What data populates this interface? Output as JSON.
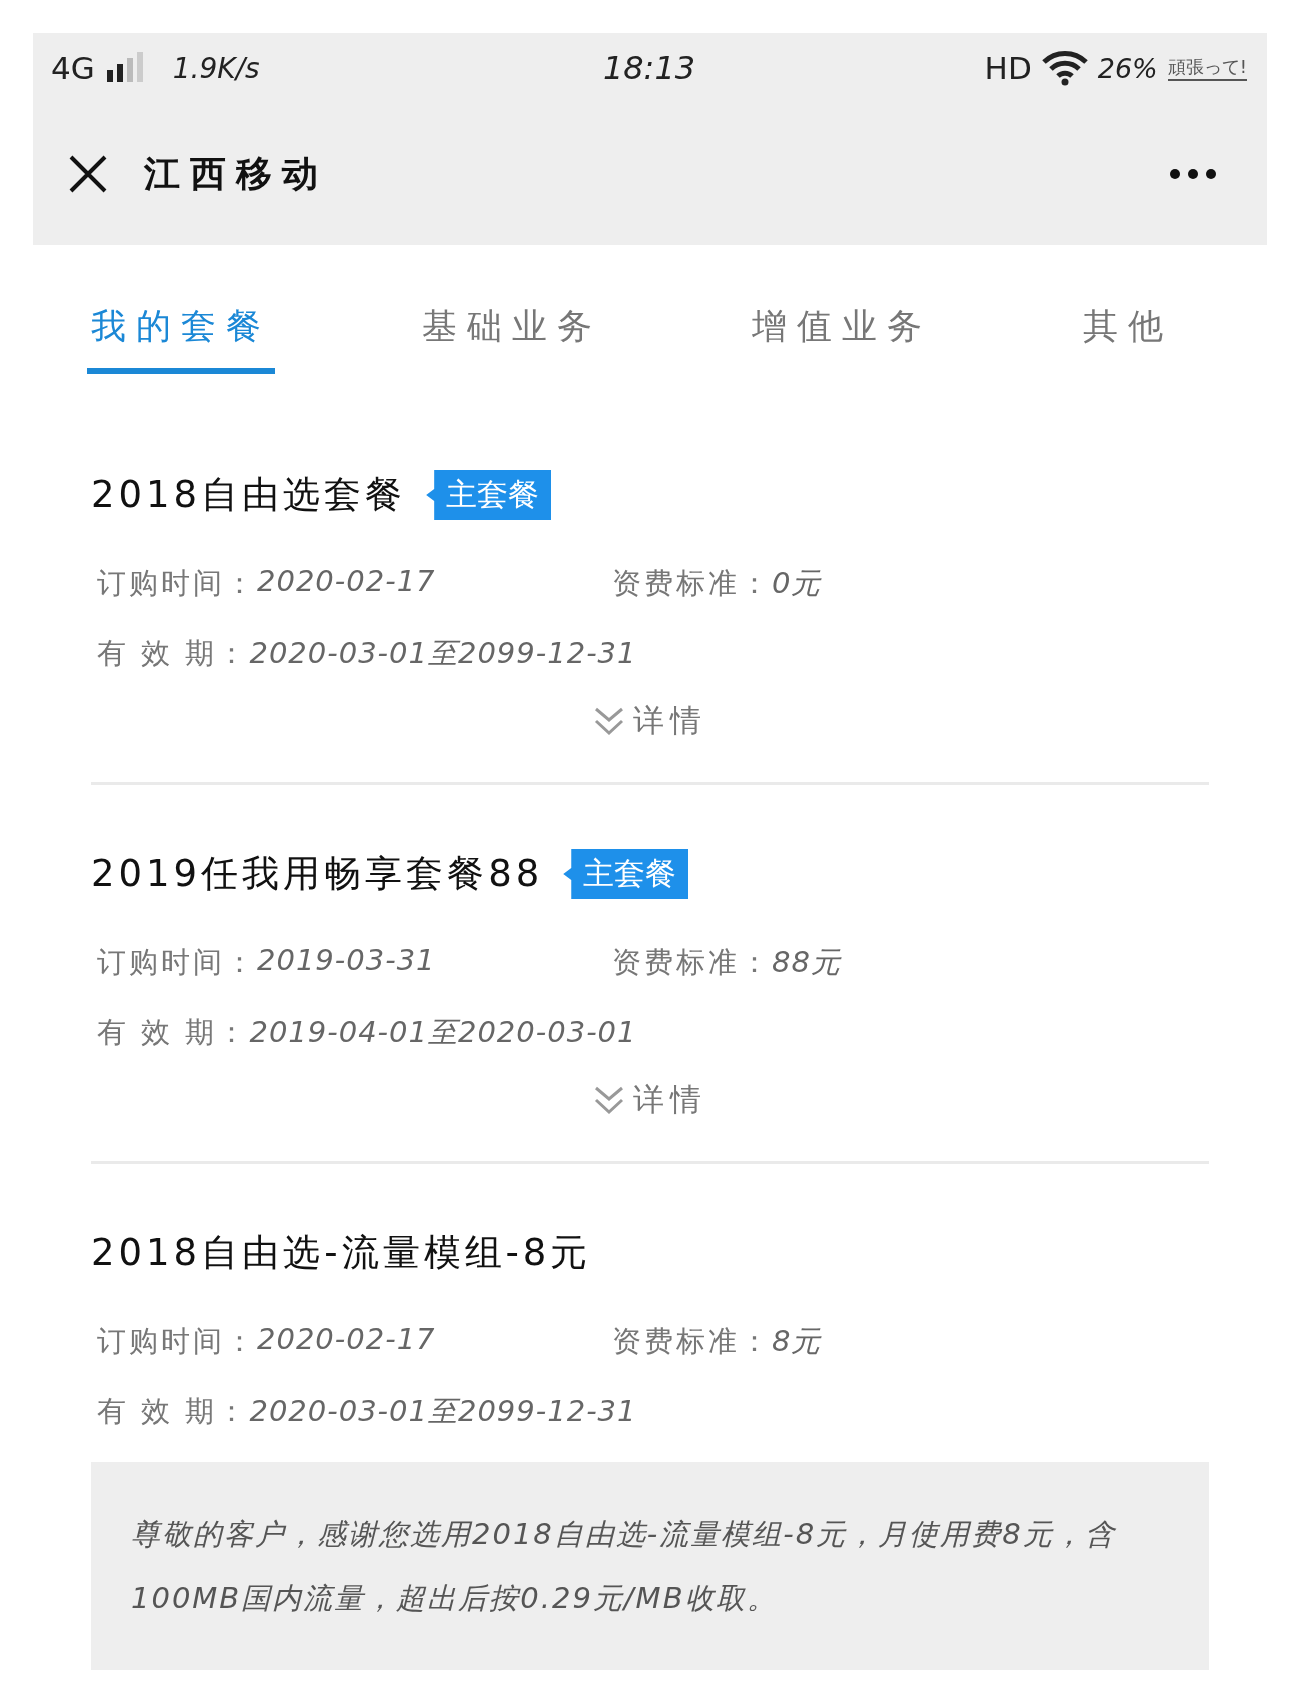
{
  "status_bar": {
    "network": "4G",
    "speed": "1.9K/s",
    "time": "18:13",
    "hd": "HD",
    "battery": "26%",
    "battery_label": "頑張って!"
  },
  "title_bar": {
    "title": "江西移动"
  },
  "tabs": [
    {
      "label": "我的套餐",
      "selected": true
    },
    {
      "label": "基础业务",
      "selected": false
    },
    {
      "label": "增值业务",
      "selected": false
    },
    {
      "label": "其他",
      "selected": false
    }
  ],
  "packages": [
    {
      "name": "2018自由选套餐",
      "badge": "主套餐",
      "order_label": "订购时间：",
      "order_date": "2020-02-17",
      "fee_label": "资费标准：",
      "fee": "0元",
      "valid_label": "有 效 期：",
      "valid": "2020-03-01至2099-12-31",
      "details": "详情"
    },
    {
      "name": "2019任我用畅享套餐88",
      "badge": "主套餐",
      "order_label": "订购时间：",
      "order_date": "2019-03-31",
      "fee_label": "资费标准：",
      "fee": "88元",
      "valid_label": "有 效 期：",
      "valid": "2019-04-01至2020-03-01",
      "details": "详情"
    },
    {
      "name": "2018自由选-流量模组-8元",
      "order_label": "订购时间：",
      "order_date": "2020-02-17",
      "fee_label": "资费标准：",
      "fee": "8元",
      "valid_label": "有 效 期：",
      "valid": "2020-03-01至2099-12-31",
      "notice": "尊敬的客户，感谢您选用2018自由选-流量模组-8元，月使用费8元，含100MB国内流量，超出后按0.29元/MB收取。"
    }
  ]
}
